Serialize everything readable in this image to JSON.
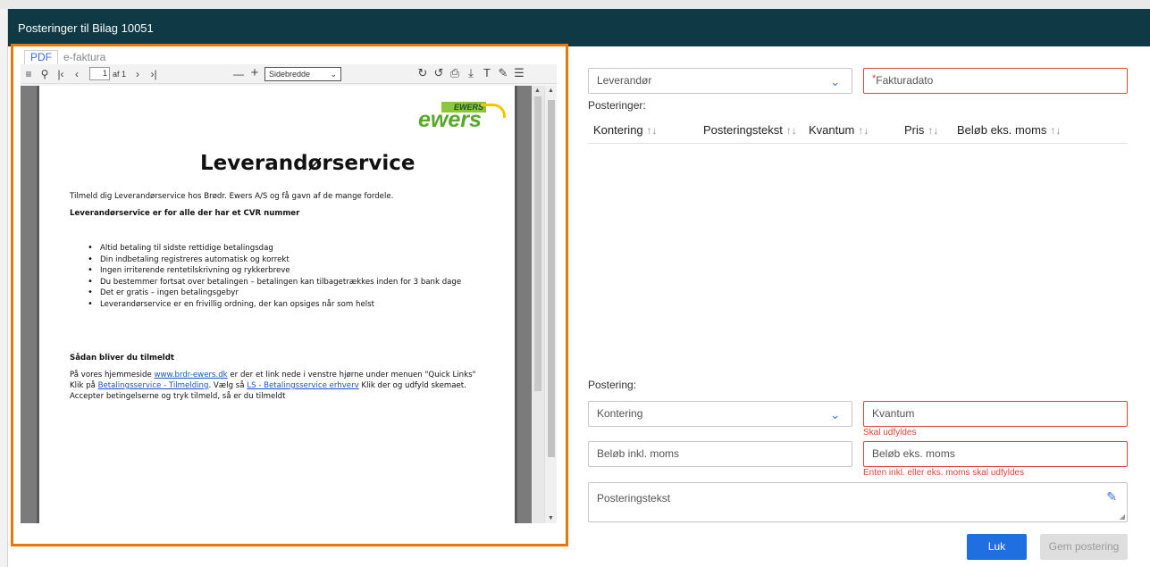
{
  "window": {
    "title": "Posteringer til Bilag 10051"
  },
  "pdf_viewer": {
    "tabs": [
      {
        "label": "PDF",
        "active": true
      },
      {
        "label": "e-faktura",
        "active": false
      }
    ],
    "toolbar": {
      "page_value": "1",
      "page_of": "af 1",
      "zoom_value": "Sidebredde"
    },
    "document": {
      "logo_top": "EWERS",
      "logo_main": "ewers",
      "heading": "Leverandørservice",
      "intro": "Tilmeld dig Leverandørservice hos Brødr. Ewers A/S og få gavn af de mange fordele.",
      "subheading": "Leverandørservice er for alle der har et CVR nummer",
      "bullets": [
        "Altid betaling til sidste rettidige betalingsdag",
        "Din indbetaling registreres automatisk og korrekt",
        "Ingen irriterende rentetilskrivning og rykkerbreve",
        "Du bestemmer fortsat over betalingen – betalingen kan tilbagetrækkes inden for 3 bank dage",
        " Det er gratis – ingen betalingsgebyr",
        "Leverandørservice er en frivillig ordning, der kan opsiges når som helst"
      ],
      "signup_heading": "Sådan bliver du tilmeldt",
      "line1_pre": "På vores hjemmeside ",
      "line1_link": "www.brdr-ewers.dk",
      "line1_post": " er der et link nede i venstre hjørne under menuen \"Quick Links\"",
      "line2_pre": "Klik på ",
      "line2_link1": "Betalingsservice - Tilmelding",
      "line2_mid": ". Vælg så ",
      "line2_link2": "LS - Betalingsservice erhverv",
      "line2_post": " Klik der og udfyld skemaet.",
      "line3": "Accepter betingelserne og tryk tilmeld, så er du tilmeldt"
    }
  },
  "form": {
    "supplier_placeholder": "Leverandør",
    "invoice_date_required": "*",
    "invoice_date_placeholder": "Fakturadato",
    "postings_label": "Posteringer:",
    "columns": [
      {
        "label": "Kontering",
        "sort": "↑↓"
      },
      {
        "label": "Posteringstekst",
        "sort": "↑↓"
      },
      {
        "label": "Kvantum",
        "sort": "↑↓"
      },
      {
        "label": "Pris",
        "sort": "↑↓"
      },
      {
        "label": "Beløb eks. moms",
        "sort": "↑↓"
      }
    ],
    "posting_label": "Postering:",
    "account_placeholder": "Kontering",
    "quantity_placeholder": "Kvantum",
    "quantity_error": "Skal udfyldes",
    "amount_incl_placeholder": "Beløb inkl. moms",
    "amount_excl_placeholder": "Beløb eks. moms",
    "amount_error": "Enten inkl. eller eks. moms skal udfyldes",
    "posting_text_placeholder": "Posteringstekst",
    "close_button": "Luk",
    "save_button": "Gem postering"
  }
}
